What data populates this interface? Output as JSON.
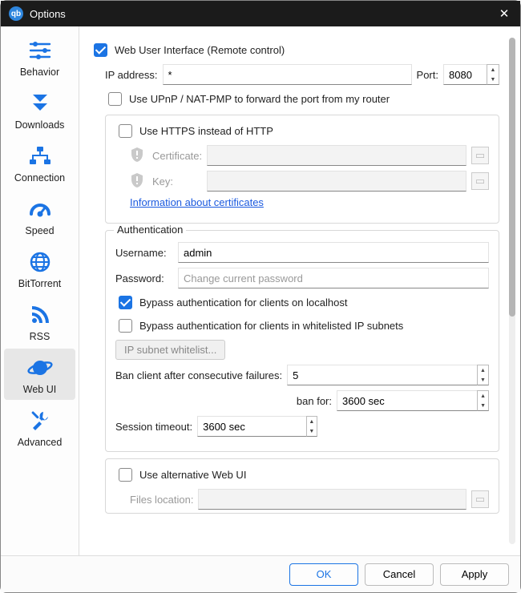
{
  "window": {
    "title": "Options"
  },
  "sidebar": {
    "items": [
      {
        "label": "Behavior"
      },
      {
        "label": "Downloads"
      },
      {
        "label": "Connection"
      },
      {
        "label": "Speed"
      },
      {
        "label": "BitTorrent"
      },
      {
        "label": "RSS"
      },
      {
        "label": "Web UI"
      },
      {
        "label": "Advanced"
      }
    ]
  },
  "webui": {
    "enabled_label": "Web User Interface (Remote control)",
    "ip_label": "IP address:",
    "ip_value": "*",
    "port_label": "Port:",
    "port_value": "8080",
    "upnp_label": "Use UPnP / NAT-PMP to forward the port from my router",
    "https": {
      "label": "Use HTTPS instead of HTTP",
      "cert_label": "Certificate:",
      "key_label": "Key:",
      "info_link": "Information about certificates"
    },
    "auth": {
      "title": "Authentication",
      "username_label": "Username:",
      "username_value": "admin",
      "password_label": "Password:",
      "password_placeholder": "Change current password",
      "bypass_localhost_label": "Bypass authentication for clients on localhost",
      "bypass_whitelist_label": "Bypass authentication for clients in whitelisted IP subnets",
      "ip_subnet_btn": "IP subnet whitelist...",
      "ban_after_label": "Ban client after consecutive failures:",
      "ban_after_value": "5",
      "ban_for_label": "ban for:",
      "ban_for_value": "3600 sec",
      "session_timeout_label": "Session timeout:",
      "session_timeout_value": "3600 sec"
    },
    "alt": {
      "label": "Use alternative Web UI",
      "files_label": "Files location:"
    }
  },
  "footer": {
    "ok": "OK",
    "cancel": "Cancel",
    "apply": "Apply"
  }
}
